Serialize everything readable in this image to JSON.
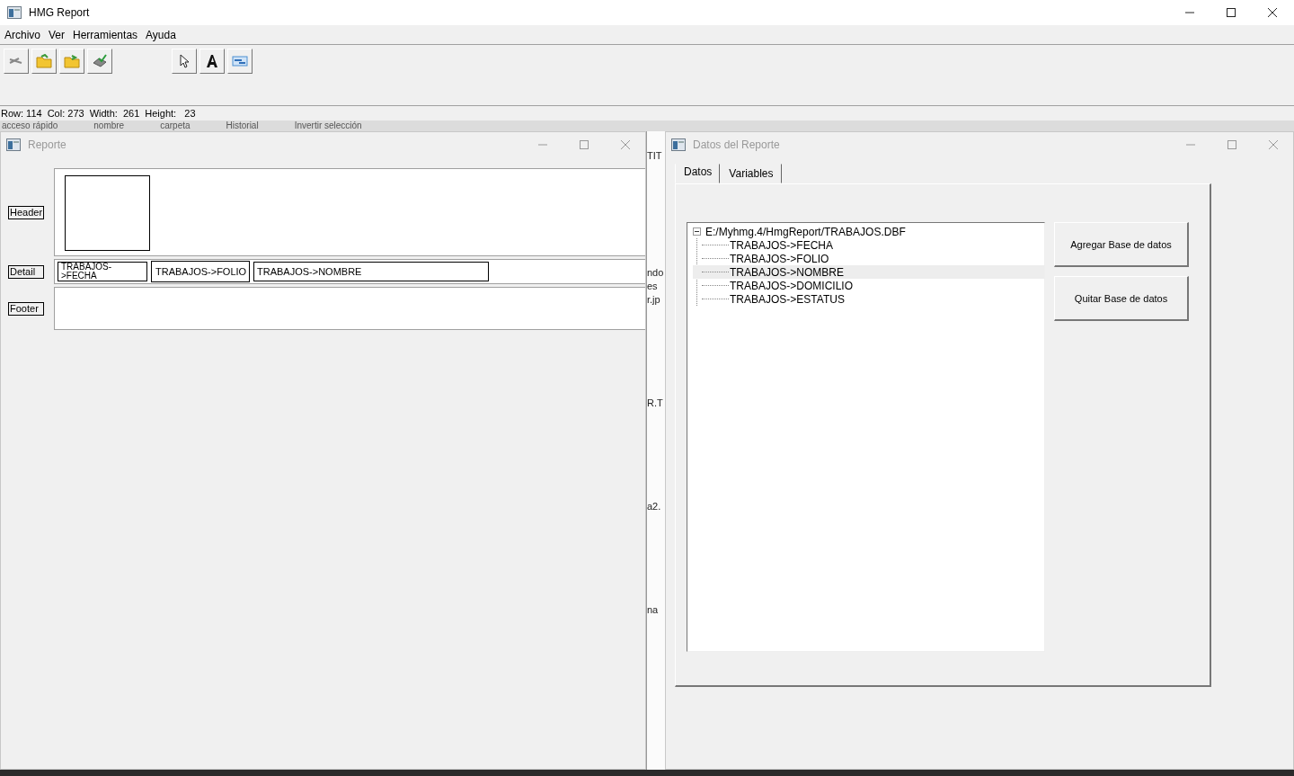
{
  "main_window": {
    "title": "HMG Report",
    "menu": [
      "Archivo",
      "Ver",
      "Herramientas",
      "Ayuda"
    ],
    "status_bar": [
      "Row: 114",
      "Col: 273",
      "Width:  261",
      "Height:   23"
    ]
  },
  "background_window": {
    "strip_texts": [
      "acceso rápido",
      "nombre",
      "carpeta",
      "Historial",
      "Invertir selección"
    ],
    "side_texts": [
      "TIT",
      "ndo",
      "es",
      "r.jp",
      "R.T",
      "a2.",
      "na"
    ]
  },
  "report_window": {
    "title": "Reporte",
    "active": false,
    "bands": [
      {
        "label": "Header",
        "kind": "header"
      },
      {
        "label": "Detail",
        "kind": "detail",
        "fields": [
          "TRABAJOS->FECHA",
          "TRABAJOS->FOLIO",
          "TRABAJOS->NOMBRE"
        ]
      },
      {
        "label": "Footer",
        "kind": "footer"
      }
    ]
  },
  "data_window": {
    "title": "Datos del Reporte",
    "active": false,
    "tabs": [
      {
        "label": "Datos",
        "selected": true
      },
      {
        "label": "Variables",
        "selected": false
      }
    ],
    "tree": {
      "label": "E:/Myhmg.4/HmgReport/TRABAJOS.DBF",
      "expanded": true,
      "children": [
        {
          "label": "TRABAJOS->FECHA",
          "selected": false
        },
        {
          "label": "TRABAJOS->FOLIO",
          "selected": false
        },
        {
          "label": "TRABAJOS->NOMBRE",
          "selected": true
        },
        {
          "label": "TRABAJOS->DOMICILIO",
          "selected": false
        },
        {
          "label": "TRABAJOS->ESTATUS",
          "selected": false
        }
      ]
    },
    "buttons": [
      "Agregar Base de datos",
      "Quitar Base de datos"
    ]
  }
}
